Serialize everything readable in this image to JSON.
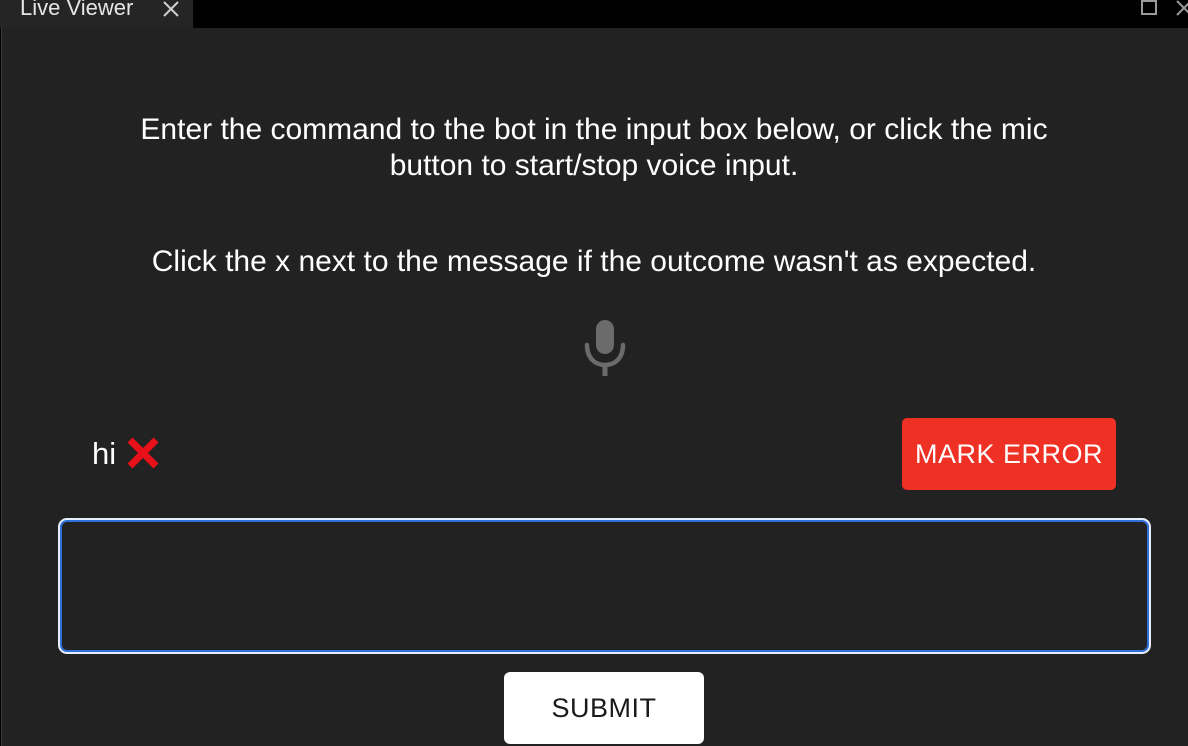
{
  "tab": {
    "title": "Live Viewer",
    "close_icon": "close-icon"
  },
  "window_controls": {
    "maximize_icon": "maximize-icon",
    "close_icon": "close-icon"
  },
  "instructions": {
    "line1": "Enter the command to the bot in the input box below, or click the mic",
    "line2": "button to start/stop voice input.",
    "line3": "Click the x next to the message if the outcome wasn't as expected."
  },
  "mic": {
    "icon": "microphone-icon",
    "color": "#6b6b6b"
  },
  "message": {
    "text": "hi",
    "mark_icon": "red-x-icon",
    "mark_color": "#e8111a"
  },
  "mark_error": {
    "label": "MARK ERROR",
    "color": "#ee3124"
  },
  "command_input": {
    "value": "",
    "placeholder": ""
  },
  "submit": {
    "label": "SUBMIT"
  },
  "colors": {
    "background": "#222222",
    "accent": "#2f6fd8"
  }
}
